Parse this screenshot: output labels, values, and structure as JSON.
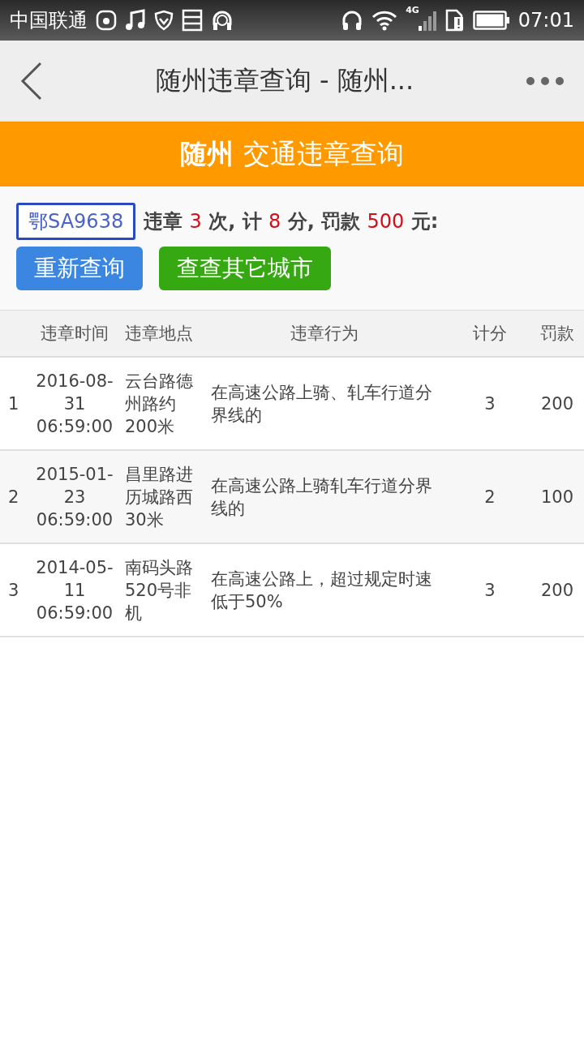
{
  "status_bar": {
    "carrier": "中国联通",
    "network": "4G",
    "time": "07:01"
  },
  "header": {
    "title": "随州违章查询 - 随州..."
  },
  "banner": {
    "city": "随州",
    "title": "交通违章查询"
  },
  "summary": {
    "plate": "鄂SA9638",
    "parts": [
      {
        "kind": "label",
        "text": "违章"
      },
      {
        "kind": "value",
        "text": "3"
      },
      {
        "kind": "label",
        "text": "次, 计"
      },
      {
        "kind": "value",
        "text": "8"
      },
      {
        "kind": "label",
        "text": "分, 罚款"
      },
      {
        "kind": "value",
        "text": "500"
      },
      {
        "kind": "label",
        "text": "元:"
      }
    ],
    "buttons": [
      {
        "kind": "primary",
        "label": "重新查询"
      },
      {
        "kind": "secondary",
        "label": "查查其它城市"
      }
    ]
  },
  "table": {
    "columns": [
      "违章时间",
      "违章地点",
      "违章行为",
      "计分",
      "罚款"
    ],
    "rows": [
      {
        "index": "1",
        "time": "2016-08-31 06:59:00",
        "place": "云台路德州路约200米",
        "action": "在高速公路上骑、轧车行道分界线的",
        "points": "3",
        "fine": "200"
      },
      {
        "index": "2",
        "time": "2015-01-23 06:59:00",
        "place": "昌里路进历城路西30米",
        "action": "在高速公路上骑轧车行道分界线的",
        "points": "2",
        "fine": "100"
      },
      {
        "index": "3",
        "time": "2014-05-11 06:59:00",
        "place": "南码头路520号非机",
        "action": "在高速公路上，超过规定时速低于50%",
        "points": "3",
        "fine": "200"
      }
    ]
  }
}
